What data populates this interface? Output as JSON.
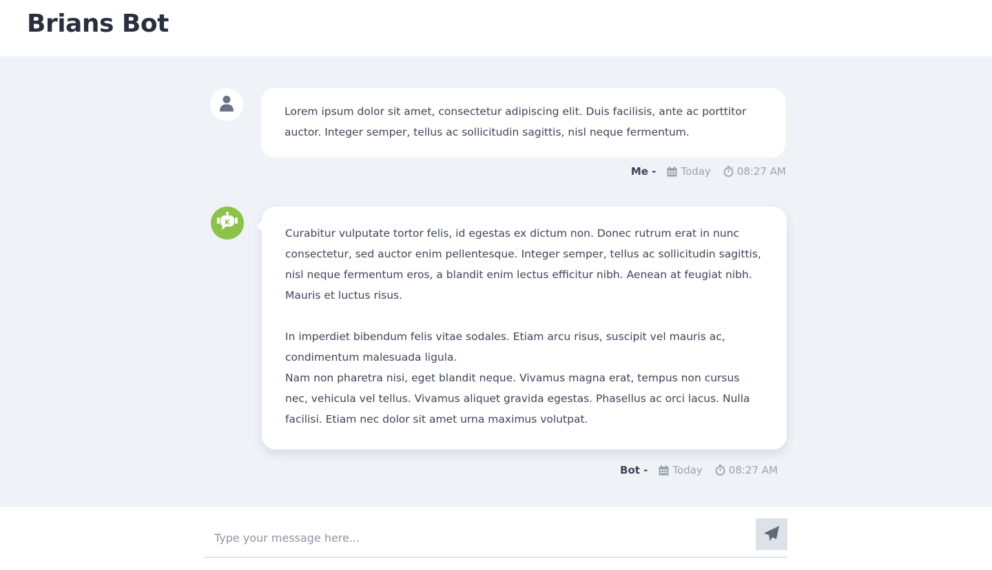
{
  "app": {
    "title": "Brians Bot"
  },
  "messages": [
    {
      "sender": "Me -",
      "avatar_icon": "user-icon",
      "paragraphs": [
        "Lorem ipsum dolor sit amet, consectetur adipiscing elit. Duis facilisis, ante ac porttitor auctor. Integer semper, tellus ac sollicitudin sagittis, nisl neque fermentum."
      ],
      "date": "Today",
      "time": "08:27 AM"
    },
    {
      "sender": "Bot -",
      "avatar_icon": "robot-icon",
      "paragraphs": [
        "Curabitur vulputate tortor felis, id egestas ex dictum non. Donec rutrum erat in nunc consectetur, sed auctor enim pellentesque. Integer semper, tellus ac sollicitudin sagittis, nisl neque fermentum eros, a blandit enim lectus efficitur nibh. Aenean at feugiat nibh. Mauris et luctus risus.",
        "In imperdiet bibendum felis vitae sodales. Etiam arcu risus, suscipit vel mauris ac, condimentum malesuada ligula.",
        "Nam non pharetra nisi, eget blandit neque. Vivamus magna erat, tempus non cursus nec, vehicula vel tellus. Vivamus aliquet gravida egestas. Phasellus ac orci lacus. Nulla facilisi. Etiam nec dolor sit amet urna maximus volutpat."
      ],
      "date": "Today",
      "time": "08:27 AM"
    }
  ],
  "composer": {
    "placeholder": "Type your message here...",
    "value": "",
    "send_icon": "paper-plane-icon"
  },
  "colors": {
    "background": "#eff3f8",
    "bot_avatar": "#8bc34a",
    "text": "#3a4256",
    "muted": "#9aa3b2"
  }
}
